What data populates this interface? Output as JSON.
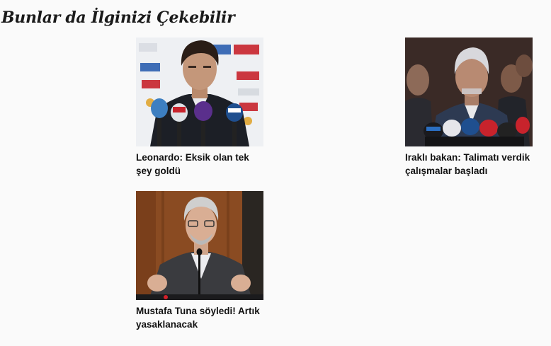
{
  "section": {
    "title": "Bunlar da İlginizi Çekebilir"
  },
  "articles": [
    {
      "title": "Leonardo: Eksik olan tek şey goldü",
      "image_icon": "press-conference-photo"
    },
    {
      "title": "Iraklı bakan: Talimatı verdik çalışmalar başladı",
      "image_icon": "minister-press-photo"
    },
    {
      "title": "Mustafa Tuna söyledi! Artık yasaklanacak",
      "image_icon": "speaker-at-podium-photo"
    }
  ],
  "colors": {
    "background": "#fafafa",
    "text": "#111111"
  }
}
